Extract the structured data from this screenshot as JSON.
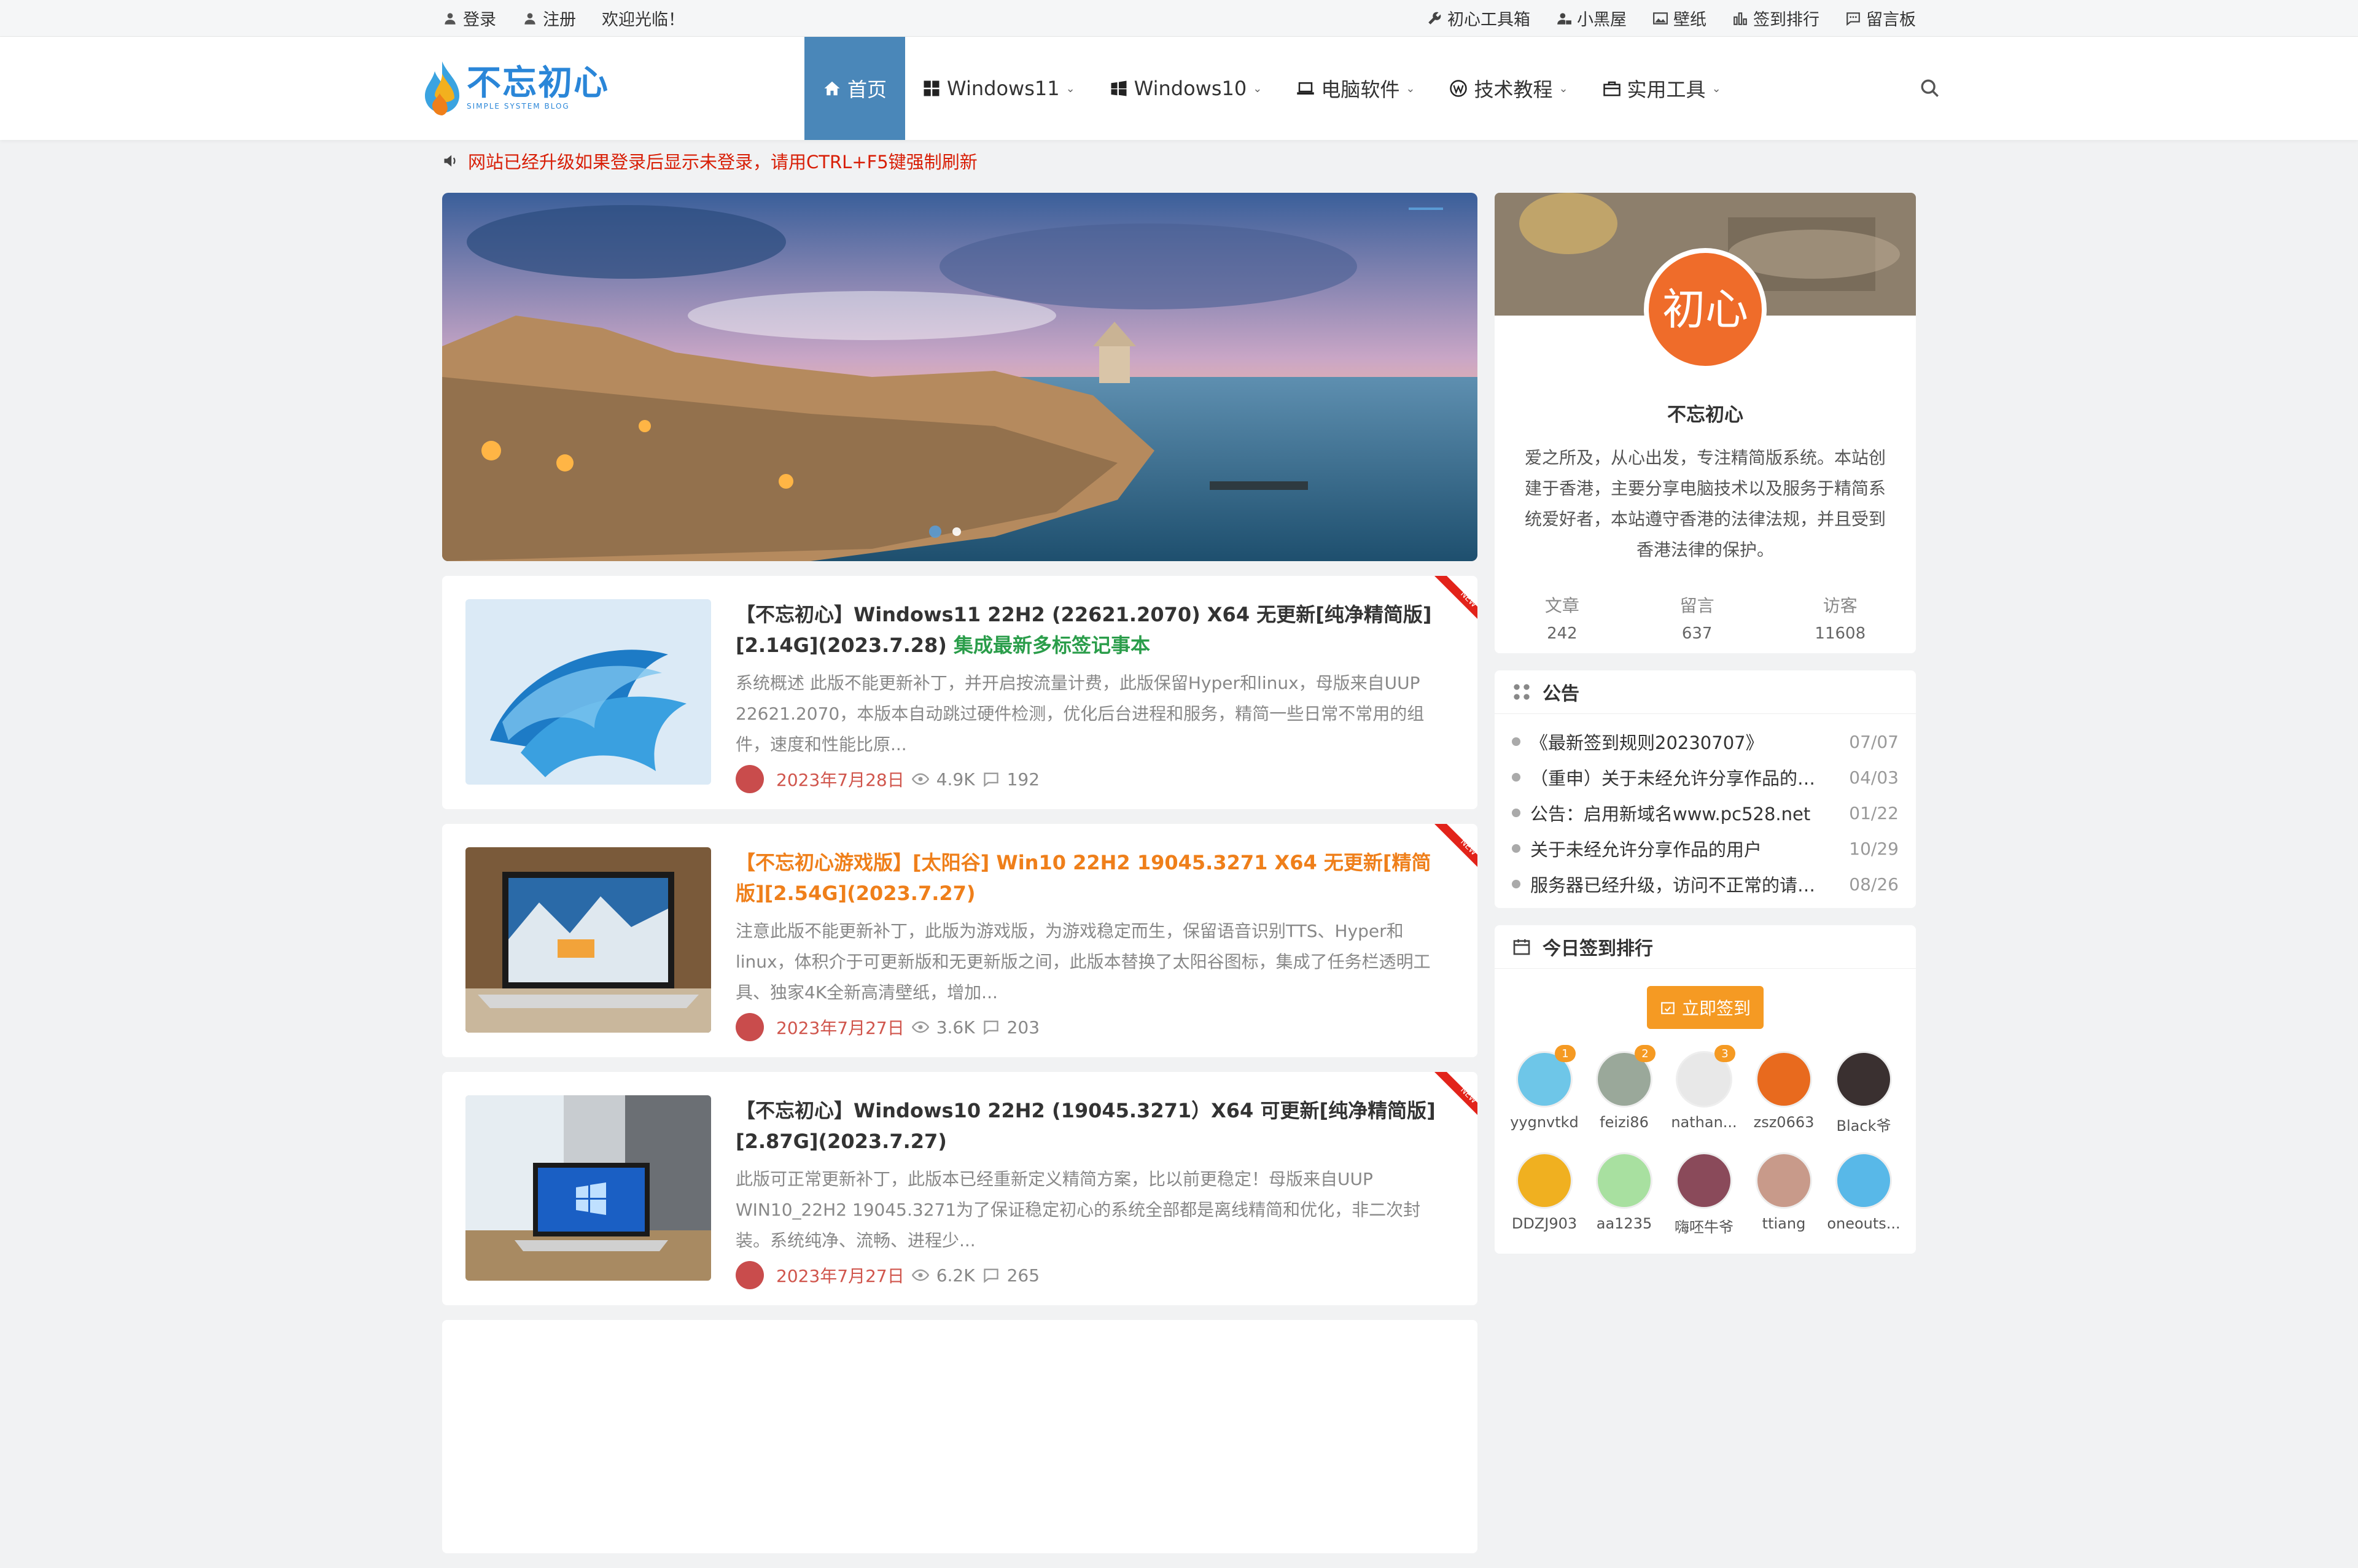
{
  "topbar": {
    "login": "登录",
    "register": "注册",
    "welcome": "欢迎光临！",
    "links": [
      "初心工具箱",
      "小黑屋",
      "壁纸",
      "签到排行",
      "留言板"
    ]
  },
  "logo": {
    "title": "不忘初心",
    "subtitle": "SIMPLE SYSTEM BLOG"
  },
  "nav": [
    {
      "label": "首页"
    },
    {
      "label": "Windows11"
    },
    {
      "label": "Windows10"
    },
    {
      "label": "电脑软件"
    },
    {
      "label": "技术教程"
    },
    {
      "label": "实用工具"
    }
  ],
  "notice": "网站已经升级如果登录后显示未登录，请用CTRL+F5键强制刷新",
  "posts": [
    {
      "title": "【不忘初心】Windows11 22H2 (22621.2070) X64 无更新[纯净精简版][2.14G](2023.7.28)",
      "title_extra": "集成最新多标签记事本",
      "excerpt": "系统概述 此版不能更新补丁，并开启按流量计费，此版保留Hyper和linux，母版来自UUP 22621.2070，本版本自动跳过硬件检测，优化后台进程和服务，精简一些日常不常用的组件，速度和性能比原...",
      "date": "2023年7月28日",
      "views": "4.9K",
      "comments": "192"
    },
    {
      "title": "【不忘初心游戏版】[太阳谷] Win10 22H2 19045.3271 X64 无更新[精简版][2.54G](2023.7.27)",
      "excerpt": "注意此版不能更新补丁，此版为游戏版，为游戏稳定而生，保留语音识别TTS、Hyper和linux，体积介于可更新版和无更新版之间，此版本替换了太阳谷图标，集成了任务栏透明工具、独家4K全新高清壁纸，增加...",
      "date": "2023年7月27日",
      "views": "3.6K",
      "comments": "203"
    },
    {
      "title": "【不忘初心】Windows10 22H2 (19045.3271）X64 可更新[纯净精简版][2.87G](2023.7.27)",
      "excerpt": "此版可正常更新补丁，此版本已经重新定义精简方案，比以前更稳定！母版来自UUP WIN10_22H2 19045.3271为了保证稳定初心的系统全部都是离线精简和优化，非二次封装。系统纯净、流畅、进程少...",
      "date": "2023年7月27日",
      "views": "6.2K",
      "comments": "265"
    }
  ],
  "profile": {
    "avatar_text": "初心",
    "name": "不忘初心",
    "desc": "爱之所及，从心出发，专注精简版系统。本站创建于香港，主要分享电脑技术以及服务于精简系统爱好者，本站遵守香港的法律法规，并且受到香港法律的保护。",
    "stats": [
      {
        "label": "文章",
        "value": "242"
      },
      {
        "label": "留言",
        "value": "637"
      },
      {
        "label": "访客",
        "value": "11608"
      }
    ]
  },
  "announcements": {
    "title": "公告",
    "items": [
      {
        "text": "《最新签到规则20230707》",
        "date": "07/07"
      },
      {
        "text": "（重申）关于未经允许分享作品的用户",
        "date": "04/03"
      },
      {
        "text": "公告：启用新域名www.pc528.net",
        "date": "01/22"
      },
      {
        "text": "关于未经允许分享作品的用户",
        "date": "10/29"
      },
      {
        "text": "服务器已经升级，访问不正常的请清...",
        "date": "08/26"
      }
    ]
  },
  "checkin": {
    "title": "今日签到排行",
    "button": "立即签到",
    "users": [
      {
        "name": "yygnvtkd",
        "rank": "1",
        "color": "#6ec6e8"
      },
      {
        "name": "feizi86",
        "rank": "2",
        "color": "#9aa89a"
      },
      {
        "name": "nathan...",
        "rank": "3",
        "color": "#e8e8e8"
      },
      {
        "name": "zsz0663",
        "rank": "",
        "color": "#e86a1e"
      },
      {
        "name": "Black爷",
        "rank": "",
        "color": "#3a3030"
      },
      {
        "name": "DDZJ903",
        "rank": "",
        "color": "#f0b020"
      },
      {
        "name": "aa1235",
        "rank": "",
        "color": "#a8e0a0"
      },
      {
        "name": "嗨呸牛爷",
        "rank": "",
        "color": "#8a4a5a"
      },
      {
        "name": "ttiang",
        "rank": "",
        "color": "#c89a8a"
      },
      {
        "name": "oneouts...",
        "rank": "",
        "color": "#58b8e8"
      }
    ]
  },
  "colors": {
    "accent": "#4a87b9",
    "orange": "#f59a23",
    "notice_red": "#d81e06"
  }
}
